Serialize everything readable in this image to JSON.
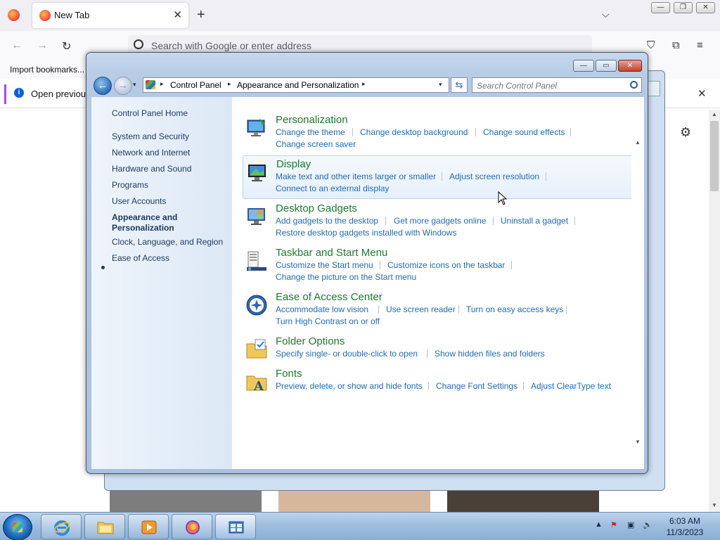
{
  "firefox": {
    "tab_title": "New Tab",
    "tab_close": "✕",
    "new_tab": "+",
    "list_all_tabs": "⌵",
    "window_controls": {
      "minimize": "—",
      "restore": "❐",
      "close": "✕"
    },
    "nav": {
      "back": "←",
      "forward": "→",
      "reload": "↻"
    },
    "url_placeholder": "Search with Google or enter address",
    "toolbar": {
      "pocket": "⛉",
      "extensions": "⧉",
      "menu": "≡"
    },
    "bookmarks_item": "Import bookmarks...",
    "infobar_text": "Open previous",
    "infobar_icon": "i",
    "infobar_close": "✕",
    "gear": "⚙"
  },
  "control_panel": {
    "window_controls": {
      "minimize": "—",
      "maximize": "▭",
      "close": "✕"
    },
    "back": "←",
    "forward": "→",
    "history": "▾",
    "breadcrumb": [
      "Control Panel",
      "Appearance and Personalization"
    ],
    "breadcrumb_sep": "▸",
    "address_dropdown": "▾",
    "refresh": "⇆",
    "search_placeholder": "Search Control Panel",
    "sidebar": {
      "home": "Control Panel Home",
      "items": [
        "System and Security",
        "Network and Internet",
        "Hardware and Sound",
        "Programs",
        "User Accounts",
        "Appearance and Personalization",
        "Clock, Language, and Region",
        "Ease of Access"
      ],
      "current_index": 5
    },
    "categories": [
      {
        "title": "Personalization",
        "icon": "personalization-icon",
        "links": [
          "Change the theme",
          "Change desktop background",
          "Change sound effects",
          "Change screen saver"
        ]
      },
      {
        "title": "Display",
        "icon": "display-icon",
        "links": [
          "Make text and other items larger or smaller",
          "Adjust screen resolution",
          "Connect to an external display"
        ]
      },
      {
        "title": "Desktop Gadgets",
        "icon": "gadgets-icon",
        "links": [
          "Add gadgets to the desktop",
          "Get more gadgets online",
          "Uninstall a gadget",
          "Restore desktop gadgets installed with Windows"
        ]
      },
      {
        "title": "Taskbar and Start Menu",
        "icon": "taskbar-icon",
        "links": [
          "Customize the Start menu",
          "Customize icons on the taskbar",
          "Change the picture on the Start menu"
        ]
      },
      {
        "title": "Ease of Access Center",
        "icon": "ease-of-access-icon",
        "links": [
          "Accommodate low vision",
          "Use screen reader",
          "Turn on easy access keys",
          "Turn High Contrast on or off"
        ]
      },
      {
        "title": "Folder Options",
        "icon": "folder-options-icon",
        "links": [
          "Specify single- or double-click to open",
          "Show hidden files and folders"
        ]
      },
      {
        "title": "Fonts",
        "icon": "fonts-icon",
        "links": [
          "Preview, delete, or show and hide fonts",
          "Change Font Settings",
          "Adjust ClearType text"
        ]
      }
    ],
    "hovered_category": "Display",
    "colors": {
      "category_title": "#1e7a2e",
      "link": "#1f6bb6",
      "sidebar_text": "#1e395b"
    }
  },
  "taskbar": {
    "items": [
      "start-button",
      "internet-explorer",
      "windows-explorer",
      "media-player",
      "firefox",
      "control-panel"
    ],
    "active": "control-panel",
    "tray": {
      "expand": "▲",
      "action_center": "⚑",
      "network": "▣",
      "volume": "🔈"
    },
    "time": "6:03 AM",
    "date": "11/3/2023"
  }
}
